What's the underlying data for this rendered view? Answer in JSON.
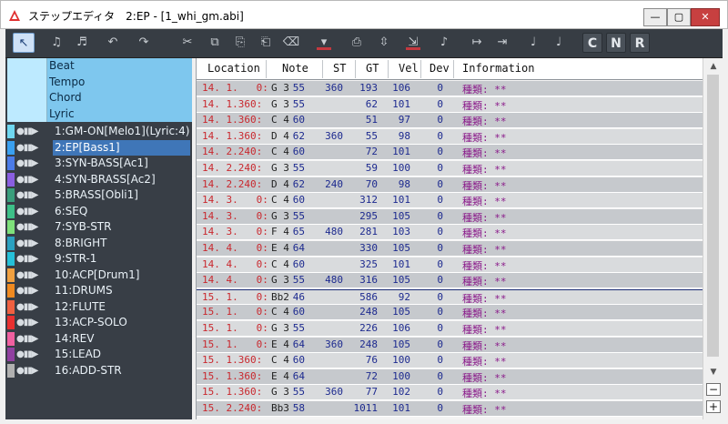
{
  "window": {
    "title": "ステップエディタ　2:EP - [1_whi_gm.abi]",
    "controls": {
      "minimize": "—",
      "maximize": "▢",
      "close": "✕"
    }
  },
  "toolbar": {
    "buttons": [
      {
        "icon": "select-arrow-icon",
        "glyph": "↖",
        "active": true
      },
      {
        "icon": "insert-note-icon",
        "glyph": "♫",
        "active": false
      },
      {
        "icon": "insert-events-icon",
        "glyph": "♬",
        "active": false
      },
      {
        "icon": "undo-icon",
        "glyph": "↶",
        "active": false
      },
      {
        "icon": "redo-icon",
        "glyph": "↷",
        "active": false
      },
      {
        "icon": "cut-icon",
        "glyph": "✂",
        "active": false
      },
      {
        "icon": "copy-icon",
        "glyph": "⧉",
        "active": false
      },
      {
        "icon": "paste-icon",
        "glyph": "⎘",
        "active": false
      },
      {
        "icon": "paste-insert-icon",
        "glyph": "⎗",
        "active": false
      },
      {
        "icon": "erase-icon",
        "glyph": "⌫",
        "active": false
      },
      {
        "icon": "delete-red-icon",
        "glyph": "▾",
        "active": false
      },
      {
        "icon": "print-icon",
        "glyph": "⎙",
        "active": false
      },
      {
        "icon": "measure-insert-icon",
        "glyph": "⇳",
        "active": false
      },
      {
        "icon": "measure-delete-icon",
        "glyph": "⇲",
        "active": false
      },
      {
        "icon": "quantize-icon",
        "glyph": "♪",
        "active": false
      },
      {
        "icon": "jump-icon",
        "glyph": "↦",
        "active": false
      },
      {
        "icon": "follow-icon",
        "glyph": "⇥",
        "active": false
      },
      {
        "icon": "note-value-icon",
        "glyph": "♩",
        "active": false
      },
      {
        "icon": "note-box-icon",
        "glyph": "♩",
        "active": false
      }
    ],
    "letters": [
      "C",
      "N",
      "R"
    ]
  },
  "left_panel": {
    "system_tracks": [
      "Beat",
      "Tempo",
      "Chord",
      "Lyric"
    ],
    "tracks": [
      {
        "name": "1:GM-ON[Melo1](Lyric:4)",
        "color": "#6fd7f0"
      },
      {
        "name": "2:EP[Bass1]",
        "color": "#3aa0f0"
      },
      {
        "name": "3:SYN-BASS[Ac1]",
        "color": "#4b7be8"
      },
      {
        "name": "4:SYN-BRASS[Ac2]",
        "color": "#8a5ee0"
      },
      {
        "name": "5:BRASS[Obli1]",
        "color": "#3a9e7c"
      },
      {
        "name": "6:SEQ",
        "color": "#3dc088"
      },
      {
        "name": "7:SYB-STR",
        "color": "#7ee07a"
      },
      {
        "name": "8:BRIGHT",
        "color": "#2aa0c0"
      },
      {
        "name": "9:STR-1",
        "color": "#25c0d8"
      },
      {
        "name": "10:ACP[Drum1]",
        "color": "#f0a040"
      },
      {
        "name": "11:DRUMS",
        "color": "#f08a20"
      },
      {
        "name": "12:FLUTE",
        "color": "#f06040"
      },
      {
        "name": "13:ACP-SOLO",
        "color": "#e83030"
      },
      {
        "name": "14:REV",
        "color": "#f060a0"
      },
      {
        "name": "15:LEAD",
        "color": "#9040a0"
      },
      {
        "name": "16:ADD-STR",
        "color": "#b0b0b0"
      }
    ],
    "selected_track": 1
  },
  "list": {
    "columns": [
      "Location",
      "Note",
      "ST",
      "GT",
      "Vel",
      "Dev",
      "Information"
    ],
    "rows": [
      {
        "loc": "14. 1.   0:",
        "note": "G 3",
        "n": "55",
        "st": "360",
        "gt": "193",
        "vel": "106",
        "dev": "0",
        "info": "種類: **"
      },
      {
        "loc": "14. 1.360:",
        "note": "G 3",
        "n": "55",
        "st": "",
        "gt": "62",
        "vel": "101",
        "dev": "0",
        "info": "種類: **"
      },
      {
        "loc": "14. 1.360:",
        "note": "C 4",
        "n": "60",
        "st": "",
        "gt": "51",
        "vel": "97",
        "dev": "0",
        "info": "種類: **"
      },
      {
        "loc": "14. 1.360:",
        "note": "D 4",
        "n": "62",
        "st": "360",
        "gt": "55",
        "vel": "98",
        "dev": "0",
        "info": "種類: **"
      },
      {
        "loc": "14. 2.240:",
        "note": "C 4",
        "n": "60",
        "st": "",
        "gt": "72",
        "vel": "101",
        "dev": "0",
        "info": "種類: **"
      },
      {
        "loc": "14. 2.240:",
        "note": "G 3",
        "n": "55",
        "st": "",
        "gt": "59",
        "vel": "100",
        "dev": "0",
        "info": "種類: **"
      },
      {
        "loc": "14. 2.240:",
        "note": "D 4",
        "n": "62",
        "st": "240",
        "gt": "70",
        "vel": "98",
        "dev": "0",
        "info": "種類: **"
      },
      {
        "loc": "14. 3.   0:",
        "note": "C 4",
        "n": "60",
        "st": "",
        "gt": "312",
        "vel": "101",
        "dev": "0",
        "info": "種類: **"
      },
      {
        "loc": "14. 3.   0:",
        "note": "G 3",
        "n": "55",
        "st": "",
        "gt": "295",
        "vel": "105",
        "dev": "0",
        "info": "種類: **"
      },
      {
        "loc": "14. 3.   0:",
        "note": "F 4",
        "n": "65",
        "st": "480",
        "gt": "281",
        "vel": "103",
        "dev": "0",
        "info": "種類: **"
      },
      {
        "loc": "14. 4.   0:",
        "note": "E 4",
        "n": "64",
        "st": "",
        "gt": "330",
        "vel": "105",
        "dev": "0",
        "info": "種類: **"
      },
      {
        "loc": "14. 4.   0:",
        "note": "C 4",
        "n": "60",
        "st": "",
        "gt": "325",
        "vel": "101",
        "dev": "0",
        "info": "種類: **"
      },
      {
        "loc": "14. 4.   0:",
        "note": "G 3",
        "n": "55",
        "st": "480",
        "gt": "316",
        "vel": "105",
        "dev": "0",
        "info": "種類: **"
      },
      {
        "loc": "15. 1.   0:",
        "note": "Bb2",
        "n": "46",
        "st": "",
        "gt": "586",
        "vel": "92",
        "dev": "0",
        "info": "種類: **",
        "bar": true
      },
      {
        "loc": "15. 1.   0:",
        "note": "C 4",
        "n": "60",
        "st": "",
        "gt": "248",
        "vel": "105",
        "dev": "0",
        "info": "種類: **"
      },
      {
        "loc": "15. 1.   0:",
        "note": "G 3",
        "n": "55",
        "st": "",
        "gt": "226",
        "vel": "106",
        "dev": "0",
        "info": "種類: **"
      },
      {
        "loc": "15. 1.   0:",
        "note": "E 4",
        "n": "64",
        "st": "360",
        "gt": "248",
        "vel": "105",
        "dev": "0",
        "info": "種類: **"
      },
      {
        "loc": "15. 1.360:",
        "note": "C 4",
        "n": "60",
        "st": "",
        "gt": "76",
        "vel": "100",
        "dev": "0",
        "info": "種類: **"
      },
      {
        "loc": "15. 1.360:",
        "note": "E 4",
        "n": "64",
        "st": "",
        "gt": "72",
        "vel": "100",
        "dev": "0",
        "info": "種類: **"
      },
      {
        "loc": "15. 1.360:",
        "note": "G 3",
        "n": "55",
        "st": "360",
        "gt": "77",
        "vel": "102",
        "dev": "0",
        "info": "種類: **"
      },
      {
        "loc": "15. 2.240:",
        "note": "Bb3",
        "n": "58",
        "st": "",
        "gt": "1011",
        "vel": "101",
        "dev": "0",
        "info": "種類: **"
      }
    ]
  },
  "scrollbar": {
    "up": "▲",
    "down": "▼",
    "zoom_minus": "−",
    "zoom_plus": "+"
  }
}
